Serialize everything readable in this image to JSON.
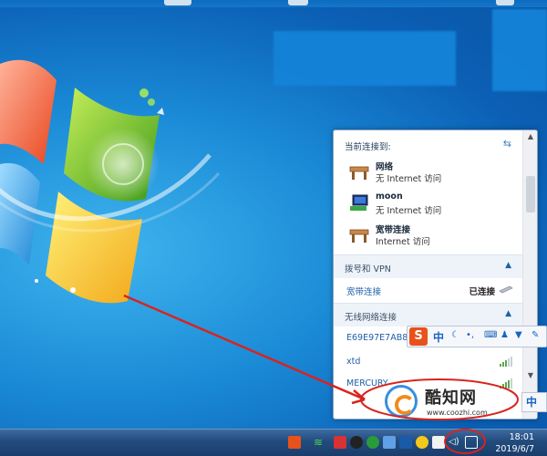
{
  "desktop": {
    "wallpaper": "windows-7-default",
    "accent": "#1a8ad6"
  },
  "network_popup": {
    "heading": "当前连接到:",
    "connections": [
      {
        "name": "网络",
        "status": "无 Internet 访问",
        "icon": "network-bench-icon"
      },
      {
        "name": "moon",
        "status": "无 Internet 访问",
        "icon": "computer-network-icon"
      },
      {
        "name": "宽带连接",
        "status": "Internet 访问",
        "icon": "network-bench-icon"
      }
    ],
    "dialup_section": {
      "title": "拨号和 VPN",
      "item": "宽带连接",
      "item_status": "已连接"
    },
    "wireless_section": {
      "title": "无线网络连接",
      "networks": [
        "E69E97E7AB8B",
        "xtd",
        "MERCURY"
      ]
    }
  },
  "ime_toolbar": {
    "logo": "S",
    "mode": "中",
    "partial_mode": "中"
  },
  "watermark": {
    "name": "酷知网",
    "url": "www.coozhi.com"
  },
  "taskbar": {
    "time": "18:01",
    "date": "2019/6/7"
  }
}
